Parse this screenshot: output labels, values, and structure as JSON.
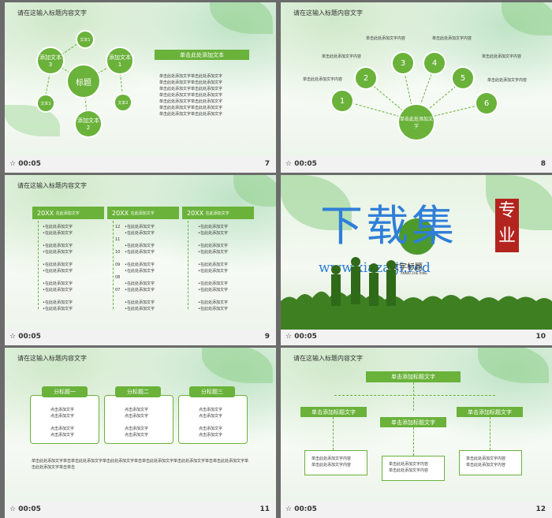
{
  "header_text": "请在这输入标题内容文字",
  "slides": [
    {
      "time": "00:05",
      "number": "7",
      "center_title": "标题",
      "nodes": [
        "添加文本3",
        "添加文本1",
        "文本2",
        "添加文本2",
        "文本3",
        "文本1"
      ],
      "bar_title": "单击此处添加文本",
      "lines": [
        "单击此处添加文字单击此处添加文字",
        "单击此处添加文字单击此处添加文字",
        "单击此处添加文字单击此处添加文字",
        "单击此处添加文字单击此处添加文字",
        "单击此处添加文字单击此处添加文字",
        "单击此处添加文字单击此处添加文字",
        "单击此处添加文字单击此处添加文字"
      ]
    },
    {
      "time": "00:05",
      "number": "8",
      "center": "单击此处添加文字",
      "numbers": [
        "1",
        "2",
        "3",
        "4",
        "5",
        "6"
      ],
      "label": "单击此处添加文字内容"
    },
    {
      "time": "00:05",
      "number": "9",
      "columns": [
        {
          "title": "20XX",
          "subtitle": "在此添加文字"
        },
        {
          "title": "20XX",
          "subtitle": "在此添加文字"
        },
        {
          "title": "20XX",
          "subtitle": "在此添加文字"
        }
      ],
      "row_nums": [
        "12",
        "11",
        "10",
        "09",
        "08",
        "07"
      ],
      "item": "•在此处添加文字"
    },
    {
      "time": "00:05",
      "number": "10",
      "watermark_main": "下载集",
      "watermark_url": "www.xiazaiji.red",
      "seal": "专业",
      "title": "文字标题",
      "subtitle": "ANNIU ZHE XING"
    },
    {
      "time": "00:05",
      "number": "11",
      "subs": [
        "分标题一",
        "分标题二",
        "分标题三"
      ],
      "sub_line": "点击添加文字",
      "footer_text": "单击此处添加文字单击单击此处添加文字单击此处添加文字单击单击此处添加文字单击此处添加文字单击单击此处添加文字单击此处添加文字单击单击"
    },
    {
      "time": "00:05",
      "number": "12",
      "top": "单击添加标题文字",
      "mid": [
        "单击添加标题文字",
        "单击添加标题文字",
        "单击添加标题文字"
      ],
      "leaf_text": "单击此处添加文字内容"
    }
  ]
}
